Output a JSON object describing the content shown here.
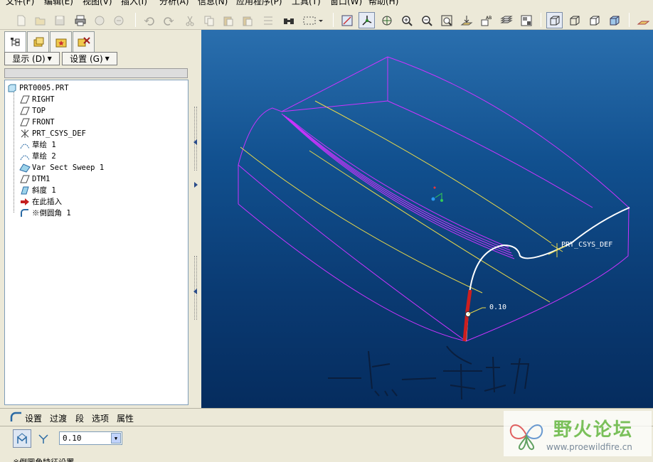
{
  "menubar": {
    "items": [
      "文件(F)",
      "编辑(E)",
      "视图(V)",
      "插入(I)",
      "分析(A)",
      "信息(N)",
      "应用程序(P)",
      "工具(T)",
      "窗口(W)",
      "帮助(H)"
    ]
  },
  "toolbar": {
    "icons": [
      "new-icon",
      "open-icon",
      "save-icon",
      "print-icon",
      "send-icon",
      "send-mail-icon",
      "undo-icon",
      "redo-icon",
      "cut-icon",
      "copy-icon",
      "paste-icon",
      "paste-special-icon",
      "regenerate-icon",
      "find-icon",
      "select-box-icon",
      "repaint-icon",
      "spin-center-icon",
      "orient-icon",
      "zoom-in-icon",
      "zoom-out-icon",
      "refit-icon",
      "datum-plane-icon",
      "datum-axis-icon",
      "layers-icon",
      "view-manager-icon",
      "wireframe-icon",
      "hidden-line-icon",
      "no-hidden-icon",
      "shading-icon",
      "datum-display-icon"
    ]
  },
  "left_panel": {
    "tabs": [
      "model-tree-tab",
      "folder-tab",
      "favorites-tab",
      "layer-tab"
    ],
    "display_button": "显示 (D)",
    "settings_button": "设置 (G)",
    "tree": [
      {
        "label": "PRT0005.PRT",
        "icon": "part-icon",
        "level": 0
      },
      {
        "label": "RIGHT",
        "icon": "datum-plane-icon",
        "level": 1
      },
      {
        "label": "TOP",
        "icon": "datum-plane-icon",
        "level": 1
      },
      {
        "label": "FRONT",
        "icon": "datum-plane-icon",
        "level": 1
      },
      {
        "label": "PRT_CSYS_DEF",
        "icon": "csys-icon",
        "level": 1
      },
      {
        "label": "草绘 1",
        "icon": "sketch-icon",
        "level": 1
      },
      {
        "label": "草绘 2",
        "icon": "sketch-icon",
        "level": 1
      },
      {
        "label": "Var Sect Sweep 1",
        "icon": "sweep-icon",
        "level": 1
      },
      {
        "label": "DTM1",
        "icon": "datum-plane-icon",
        "level": 1
      },
      {
        "label": "斜度 1",
        "icon": "draft-icon",
        "level": 1
      },
      {
        "label": "在此插入",
        "icon": "insert-arrow-icon",
        "level": 1
      },
      {
        "label": "※倒圆角 1",
        "icon": "round-icon",
        "level": 1
      }
    ]
  },
  "viewport": {
    "csys_label": "PRT_CSYS_DEF",
    "dimension_value": "0.10",
    "handwriting": "一点一条边",
    "colors": {
      "bg_top": "#2a6fae",
      "bg_bottom": "#052c5e",
      "edge": "#cc33ff",
      "datum": "#e8d84a"
    }
  },
  "dashboard": {
    "tabs": [
      "设置",
      "过渡",
      "段",
      "选项",
      "属性"
    ],
    "radius_value": "0.10",
    "status_text": "※倒圆角特征设置"
  },
  "watermark": {
    "title": "野火论坛",
    "url": "www.proewildfire.cn"
  }
}
